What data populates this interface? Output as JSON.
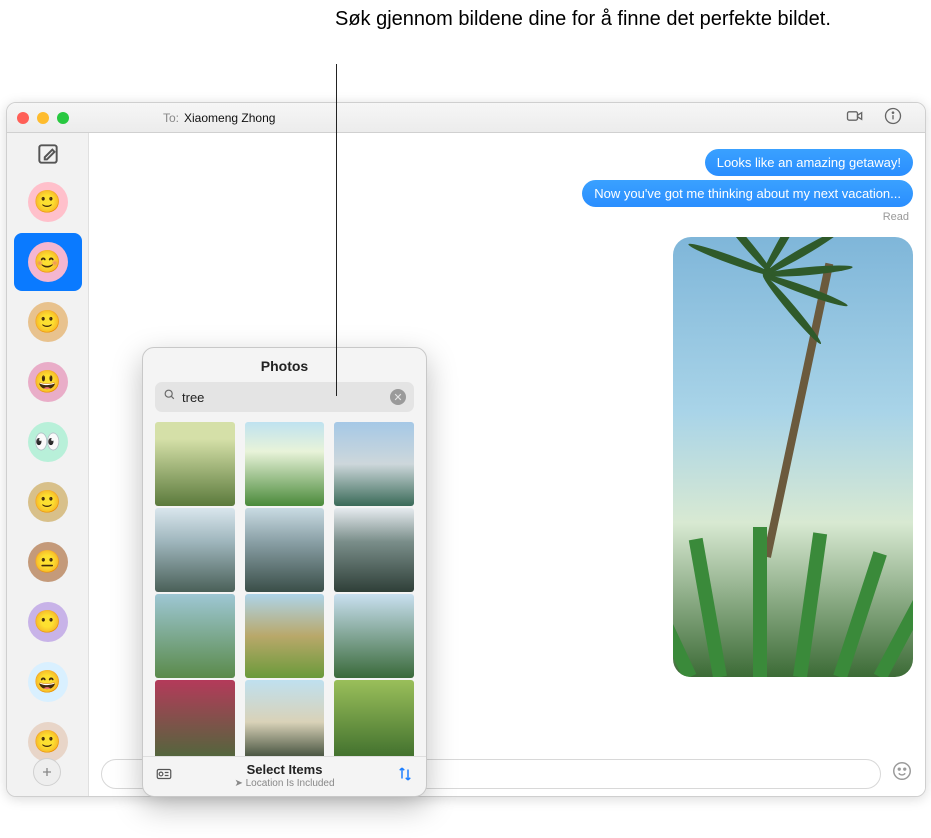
{
  "callout": "Søk gjennom bildene dine for å finne det perfekte bildet.",
  "header": {
    "to_label": "To:",
    "to_name": "Xiaomeng Zhong"
  },
  "messages": {
    "bubble1": "Looks like an amazing getaway!",
    "bubble2": "Now you've got me thinking about my next vacation...",
    "read_label": "Read"
  },
  "photos_popover": {
    "title": "Photos",
    "search_value": "tree",
    "footer_title": "Select Items",
    "footer_sub": "Location Is Included"
  },
  "sidebar": {
    "conversations": [
      {
        "selected": false
      },
      {
        "selected": true
      },
      {
        "selected": false
      },
      {
        "selected": false
      },
      {
        "selected": false
      },
      {
        "selected": false
      },
      {
        "selected": false
      },
      {
        "selected": false
      },
      {
        "selected": false
      },
      {
        "selected": false
      }
    ]
  }
}
